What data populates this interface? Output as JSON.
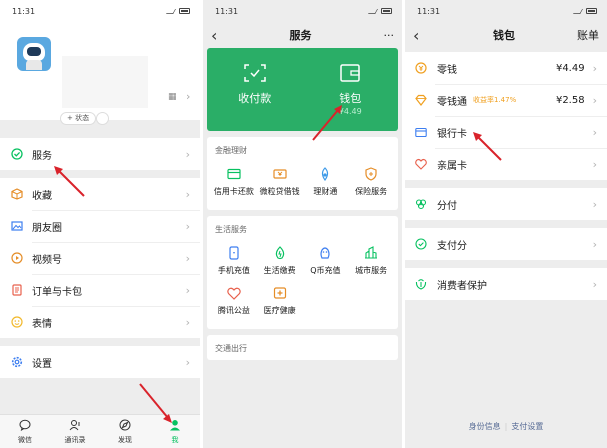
{
  "status_time": "11:31",
  "colors": {
    "accent": "#07c160",
    "card_green": "#2aae67",
    "arrow_red": "#d9232b",
    "link": "#576b95"
  },
  "me": {
    "status_button": "+ 状态",
    "menu": [
      {
        "label": "服务",
        "icon": "service-icon"
      },
      {
        "label": "收藏",
        "icon": "favorites-icon"
      },
      {
        "label": "朋友圈",
        "icon": "moments-icon"
      },
      {
        "label": "视频号",
        "icon": "channels-icon"
      },
      {
        "label": "订单与卡包",
        "icon": "orders-icon"
      },
      {
        "label": "表情",
        "icon": "stickers-icon"
      },
      {
        "label": "设置",
        "icon": "settings-icon"
      }
    ],
    "tabs": [
      {
        "label": "微信",
        "icon": "chat-icon"
      },
      {
        "label": "通讯录",
        "icon": "contacts-icon"
      },
      {
        "label": "发现",
        "icon": "discover-icon"
      },
      {
        "label": "我",
        "icon": "me-icon",
        "active": true
      }
    ]
  },
  "services": {
    "title": "服务",
    "more": "···",
    "card": {
      "pay_label": "收付款",
      "wallet_label": "钱包",
      "wallet_balance": "¥4.49"
    },
    "sections": [
      {
        "title": "金融理财",
        "items": [
          {
            "label": "信用卡还款",
            "icon": "credit-card-icon"
          },
          {
            "label": "微粒贷借钱",
            "icon": "loan-icon"
          },
          {
            "label": "理财通",
            "icon": "wealth-icon"
          },
          {
            "label": "保险服务",
            "icon": "insurance-icon"
          }
        ]
      },
      {
        "title": "生活服务",
        "items": [
          {
            "label": "手机充值",
            "icon": "phone-topup-icon"
          },
          {
            "label": "生活缴费",
            "icon": "utilities-icon"
          },
          {
            "label": "Q币充值",
            "icon": "qcoin-icon"
          },
          {
            "label": "城市服务",
            "icon": "city-icon"
          },
          {
            "label": "腾讯公益",
            "icon": "charity-icon"
          },
          {
            "label": "医疗健康",
            "icon": "medical-icon"
          }
        ]
      },
      {
        "title": "交通出行",
        "items": []
      }
    ]
  },
  "wallet": {
    "title": "钱包",
    "right_action": "账单",
    "group1": [
      {
        "label": "零钱",
        "value": "¥4.49",
        "icon": "change-icon"
      },
      {
        "label": "零钱通",
        "badge": "收益率1.47%",
        "value": "¥2.58",
        "icon": "diamond-icon"
      },
      {
        "label": "银行卡",
        "icon": "bank-card-icon"
      },
      {
        "label": "亲属卡",
        "icon": "family-card-icon"
      }
    ],
    "group2": [
      {
        "label": "分付",
        "icon": "fenfu-icon"
      }
    ],
    "group3": [
      {
        "label": "支付分",
        "icon": "payscore-icon"
      }
    ],
    "group4": [
      {
        "label": "消费者保护",
        "icon": "protection-icon"
      }
    ],
    "footer": {
      "identity": "身份信息",
      "pay_settings": "支付设置"
    }
  }
}
